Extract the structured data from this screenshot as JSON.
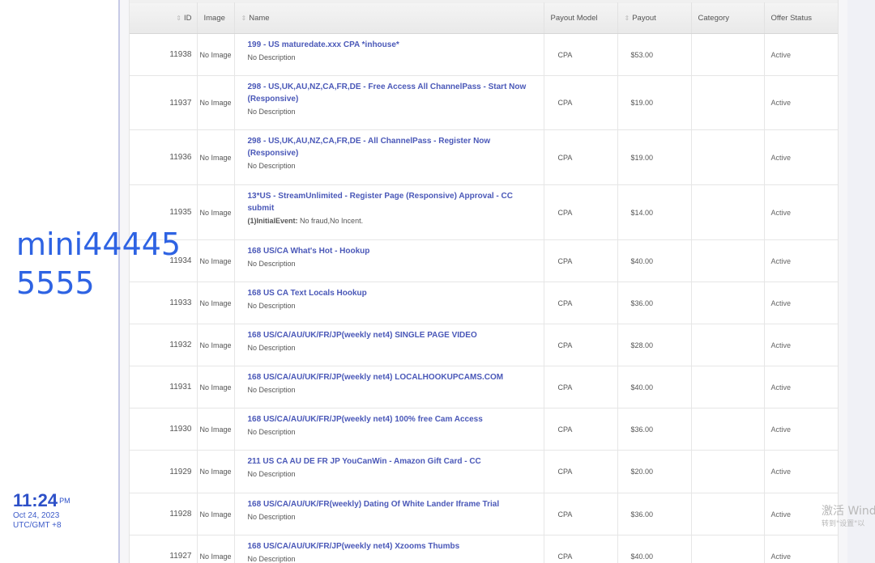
{
  "table": {
    "headers": {
      "id": "ID",
      "image": "Image",
      "name": "Name",
      "payout_model": "Payout Model",
      "payout": "Payout",
      "category": "Category",
      "status": "Offer Status"
    },
    "rows": [
      {
        "id": "11938",
        "image": "No Image",
        "name": "199 - US maturedate.xxx CPA *inhouse*",
        "desc": "No Description",
        "desc_label": "",
        "model": "CPA",
        "payout": "$53.00",
        "category": "",
        "status": "Active"
      },
      {
        "id": "11937",
        "image": "No Image",
        "name": "298 - US,UK,AU,NZ,CA,FR,DE - Free Access All ChannelPass - Start Now (Responsive)",
        "desc": "No Description",
        "desc_label": "",
        "model": "CPA",
        "payout": "$19.00",
        "category": "",
        "status": "Active"
      },
      {
        "id": "11936",
        "image": "No Image",
        "name": "298 - US,UK,AU,NZ,CA,FR,DE - All ChannelPass - Register Now (Responsive)",
        "desc": "No Description",
        "desc_label": "",
        "model": "CPA",
        "payout": "$19.00",
        "category": "",
        "status": "Active"
      },
      {
        "id": "11935",
        "image": "No Image",
        "name": "13*US - StreamUnlimited - Register Page (Responsive) Approval - CC submit",
        "desc": "No fraud,No Incent.",
        "desc_label": "(1)InitialEvent:",
        "model": "CPA",
        "payout": "$14.00",
        "category": "",
        "status": "Active"
      },
      {
        "id": "11934",
        "image": "No Image",
        "name": "168 US/CA What's Hot - Hookup",
        "desc": "No Description",
        "desc_label": "",
        "model": "CPA",
        "payout": "$40.00",
        "category": "",
        "status": "Active"
      },
      {
        "id": "11933",
        "image": "No Image",
        "name": "168 US CA Text Locals Hookup",
        "desc": "No Description",
        "desc_label": "",
        "model": "CPA",
        "payout": "$36.00",
        "category": "",
        "status": "Active"
      },
      {
        "id": "11932",
        "image": "No Image",
        "name": "168 US/CA/AU/UK/FR/JP(weekly net4) SINGLE PAGE VIDEO",
        "desc": "No Description",
        "desc_label": "",
        "model": "CPA",
        "payout": "$28.00",
        "category": "",
        "status": "Active"
      },
      {
        "id": "11931",
        "image": "No Image",
        "name": "168 US/CA/AU/UK/FR/JP(weekly net4) LOCALHOOKUPCAMS.COM",
        "desc": "No Description",
        "desc_label": "",
        "model": "CPA",
        "payout": "$40.00",
        "category": "",
        "status": "Active"
      },
      {
        "id": "11930",
        "image": "No Image",
        "name": "168 US/CA/AU/UK/FR/JP(weekly net4) 100% free Cam Access",
        "desc": "No Description",
        "desc_label": "",
        "model": "CPA",
        "payout": "$36.00",
        "category": "",
        "status": "Active"
      },
      {
        "id": "11929",
        "image": "No Image",
        "name": "211 US CA AU DE FR JP YouCanWin - Amazon Gift Card - CC",
        "desc": "No Description",
        "desc_label": "",
        "model": "CPA",
        "payout": "$20.00",
        "category": "",
        "status": "Active"
      },
      {
        "id": "11928",
        "image": "No Image",
        "name": "168 US/CA/AU/UK/FR(weekly) Dating Of White Lander Iframe Trial",
        "desc": "No Description",
        "desc_label": "",
        "model": "CPA",
        "payout": "$36.00",
        "category": "",
        "status": "Active"
      },
      {
        "id": "11927",
        "image": "No Image",
        "name": "168 US/CA/AU/UK/FR/JP(weekly net4) Xzooms Thumbs",
        "desc": "No Description",
        "desc_label": "",
        "model": "CPA",
        "payout": "$40.00",
        "category": "",
        "status": "Active"
      }
    ]
  },
  "watermark": {
    "text": "mini444455555"
  },
  "clock": {
    "time": "11:24",
    "ampm": "PM",
    "date": "Oct 24, 2023",
    "tz": "UTC/GMT +8"
  },
  "activation": {
    "line1": "激活 Wind",
    "line2": "转到\"设置\"以"
  },
  "colors": {
    "link": "#4a58b8",
    "watermark": "#2e63e3",
    "clock": "#2d50c8"
  }
}
